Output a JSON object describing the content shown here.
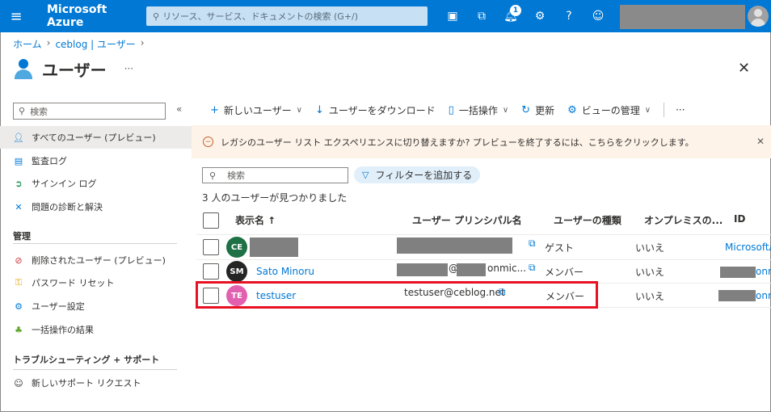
{
  "topbar": {
    "brand": "Microsoft Azure",
    "search_placeholder": "リソース、サービス、ドキュメントの検索 (G+/)",
    "notification_count": "1"
  },
  "breadcrumb": [
    "ホーム",
    "ceblog | ユーザー"
  ],
  "page": {
    "title": "ユーザー",
    "more": "···"
  },
  "sidebar": {
    "search_placeholder": "検索",
    "items": [
      {
        "label": "すべてのユーザー (プレビュー)",
        "icon": "user-icon",
        "active": true
      },
      {
        "label": "監査ログ",
        "icon": "log-icon"
      },
      {
        "label": "サインイン ログ",
        "icon": "signin-icon"
      },
      {
        "label": "問題の診断と解決",
        "icon": "wrench-icon"
      }
    ],
    "section_manage": "管理",
    "manage_items": [
      {
        "label": "削除されたユーザー (プレビュー)",
        "icon": "deleted-user-icon"
      },
      {
        "label": "パスワード リセット",
        "icon": "key-icon"
      },
      {
        "label": "ユーザー設定",
        "icon": "user-settings-icon"
      },
      {
        "label": "一括操作の結果",
        "icon": "bulk-results-icon"
      }
    ],
    "section_support": "トラブルシューティング + サポート",
    "support_items": [
      {
        "label": "新しいサポート リクエスト",
        "icon": "support-icon"
      }
    ]
  },
  "commands": {
    "new_user": "新しいユーザー",
    "download": "ユーザーをダウンロード",
    "bulk": "一括操作",
    "refresh": "更新",
    "manage_view": "ビューの管理",
    "more": "···"
  },
  "banner": {
    "text": "レガシのユーザー リスト エクスペリエンスに切り替えますか? プレビューを終了するには、こちらをクリックします。"
  },
  "list": {
    "search_placeholder": "検索",
    "add_filter": "フィルターを追加する",
    "result_count": "3 人のユーザーが見つかりました",
    "columns": {
      "display_name": "表示名 ↑",
      "upn": "ユーザー プリンシパル名",
      "user_type": "ユーザーの種類",
      "onprem": "オンプレミスの...",
      "id": "ID"
    },
    "rows": [
      {
        "initials": "CE",
        "avatar_color": "#1e7145",
        "name": "",
        "upn": "",
        "upn_suffix": "",
        "type": "ゲスト",
        "onprem": "いいえ",
        "id": "MicrosoftA"
      },
      {
        "initials": "SM",
        "avatar_color": "#252525",
        "name": "Sato Minoru",
        "upn": "@",
        "upn_suffix": "onmic...",
        "type": "メンバー",
        "onprem": "いいえ",
        "id": "onm"
      },
      {
        "initials": "TE",
        "avatar_color": "#e35fb0",
        "name": "testuser",
        "upn": "testuser@ceblog.net",
        "upn_suffix": "",
        "type": "メンバー",
        "onprem": "いいえ",
        "id": "onm"
      }
    ]
  }
}
